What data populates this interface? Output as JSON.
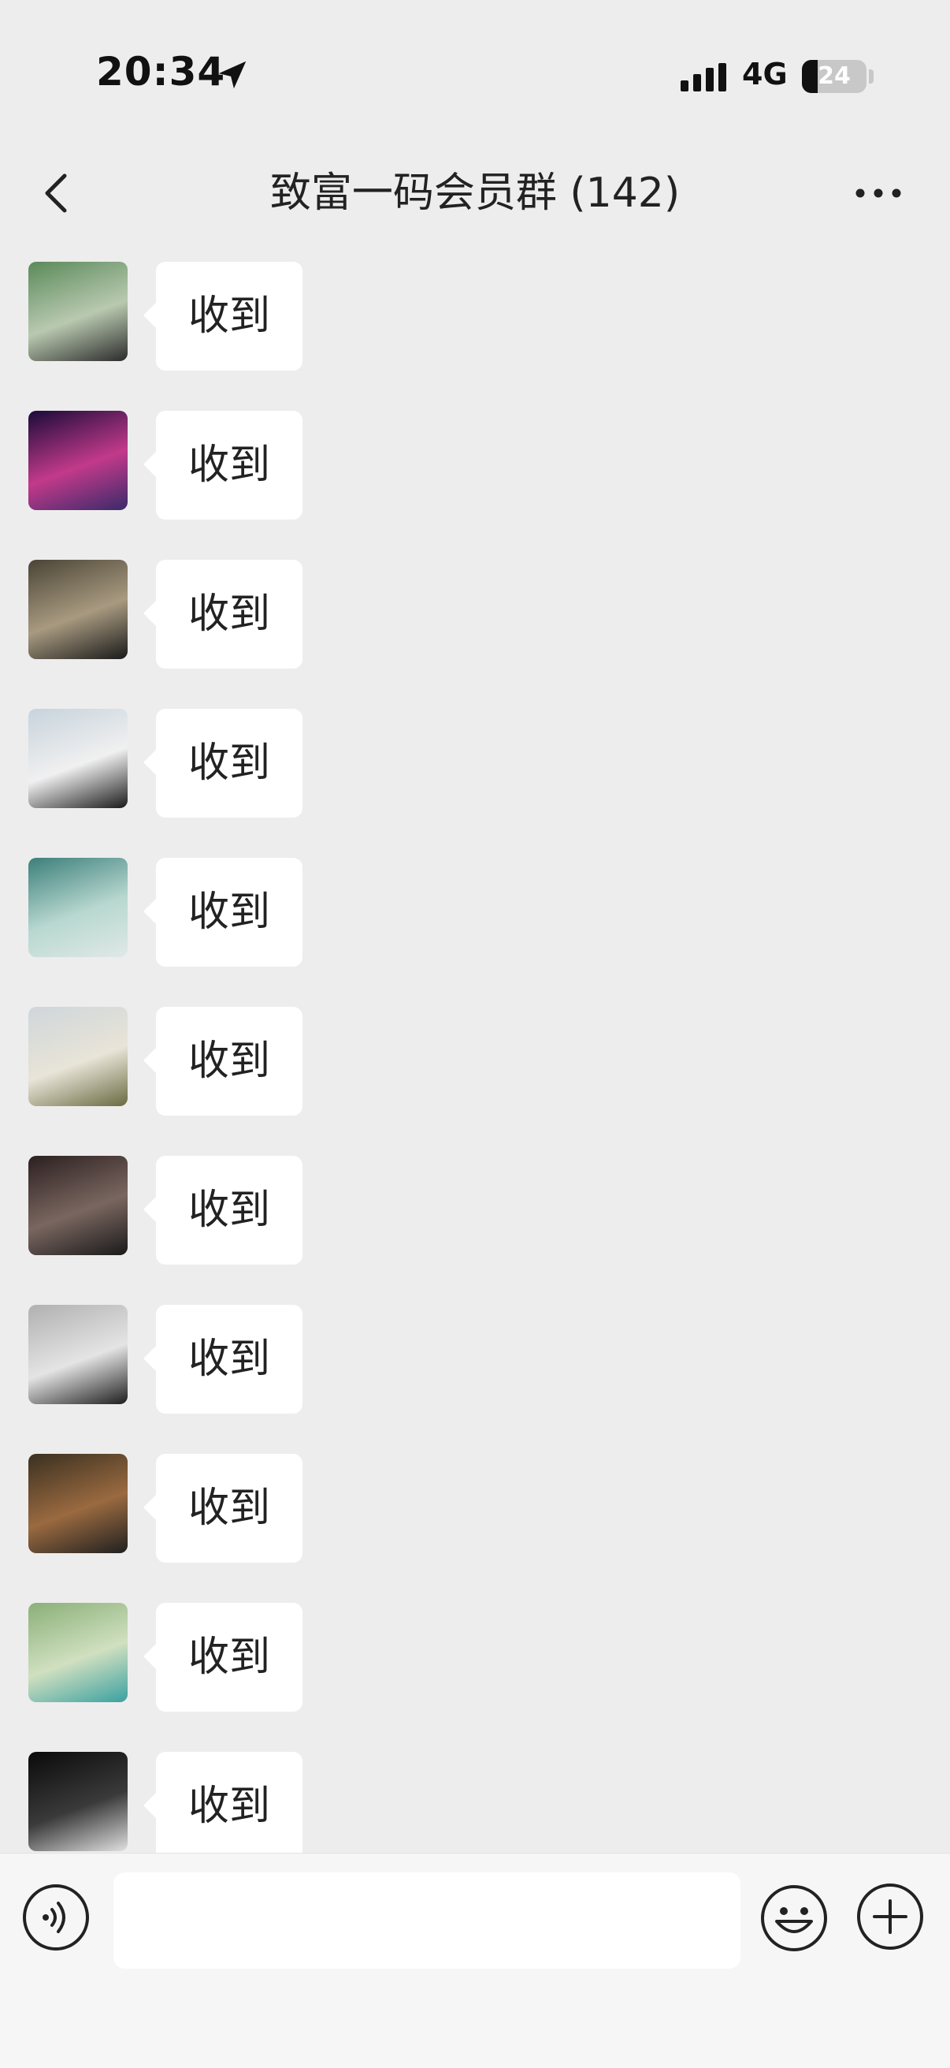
{
  "status": {
    "time": "20:34",
    "network": "4G",
    "battery": "24",
    "battery_level": 0.24
  },
  "header": {
    "title": "致富一码会员群 (142)",
    "back_icon": "chevron-left-icon",
    "more_icon": "more-dots-icon"
  },
  "messages": [
    {
      "text": "收到"
    },
    {
      "text": "收到"
    },
    {
      "text": "收到"
    },
    {
      "text": "收到"
    },
    {
      "text": "收到"
    },
    {
      "text": "收到"
    },
    {
      "text": "收到"
    },
    {
      "text": "收到"
    },
    {
      "text": "收到"
    },
    {
      "text": "收到"
    },
    {
      "text": "收到"
    }
  ],
  "input": {
    "value": "",
    "placeholder": ""
  },
  "colors": {
    "background": "#ededed",
    "bubble": "#ffffff",
    "input_bar": "#f6f6f6"
  }
}
